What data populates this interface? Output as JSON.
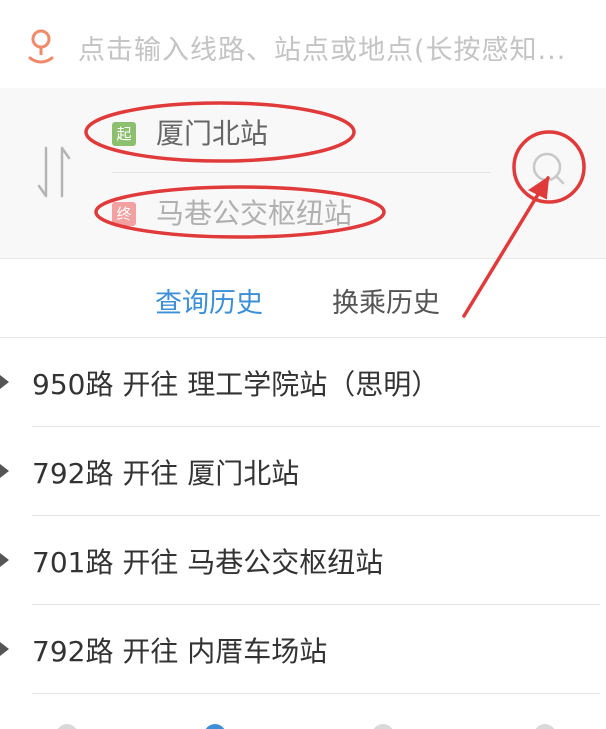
{
  "search": {
    "placeholder": "点击输入线路、站点或地点(长按感知..."
  },
  "route": {
    "start_badge": "起",
    "start_station": "厦门北站",
    "end_badge": "终",
    "end_station": "马巷公交枢纽站"
  },
  "tabs": [
    {
      "label": "查询历史",
      "active": true
    },
    {
      "label": "换乘历史",
      "active": false
    }
  ],
  "history": [
    {
      "text": "950路 开往 理工学院站（思明）"
    },
    {
      "text": "792路 开往 厦门北站"
    },
    {
      "text": "701路 开往 马巷公交枢纽站"
    },
    {
      "text": "792路 开往 内厝车场站"
    }
  ],
  "colors": {
    "accent_blue": "#3d8fd8",
    "start_green": "#8cc06e",
    "end_pink": "#f2a0a0",
    "annotation_red": "#e03a3a",
    "location_icon": "#f08a6a"
  },
  "icons": {
    "location": "location-pin-icon",
    "swap": "swap-arrows-icon",
    "search": "search-icon",
    "history_arrow": "play-arrow-icon"
  }
}
